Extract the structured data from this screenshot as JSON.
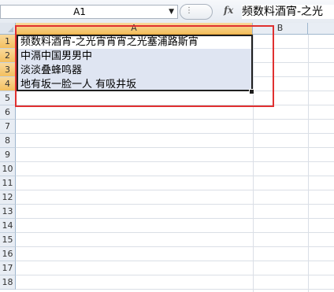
{
  "name_box": {
    "value": "A1",
    "dropdown_icon": "chevron-down-icon"
  },
  "formula_bar": {
    "fx_label": "fx",
    "content": "频数料酒宵-之光"
  },
  "columns": [
    {
      "label": "A",
      "selected": true
    },
    {
      "label": "B",
      "selected": false
    }
  ],
  "rows": [
    "1",
    "2",
    "3",
    "4",
    "5",
    "6",
    "7",
    "8",
    "9",
    "10",
    "11",
    "12",
    "13",
    "14",
    "15",
    "16",
    "17",
    "18"
  ],
  "cells": [
    "频数料酒宵-之光宵宵宵之光塞浦路斯宵",
    "中滆中国男男中",
    "淡淡叠蜂鸣器",
    "地有坂一脸一人  有吸井坂"
  ],
  "colors": {
    "selection_fill": "#dfe5f2",
    "annotation": "#e03030",
    "header_selected": "#f3bf5f"
  }
}
